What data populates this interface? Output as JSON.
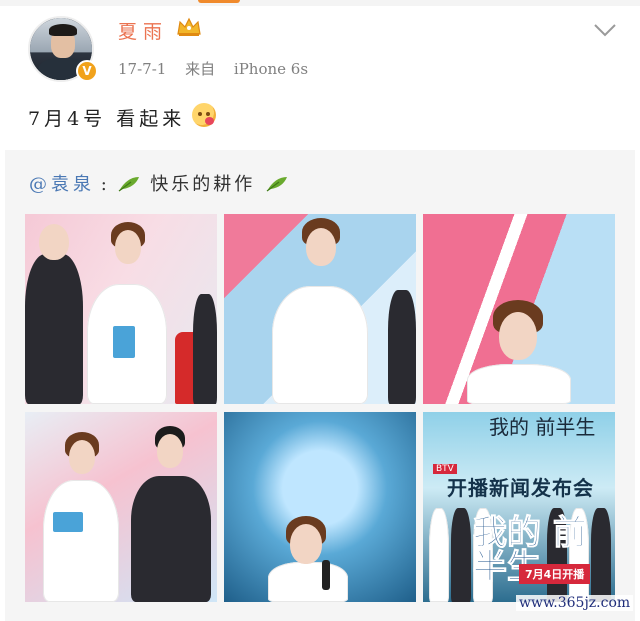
{
  "post": {
    "author": {
      "name": "夏雨",
      "badge": "V"
    },
    "meta": {
      "date": "17-7-1",
      "source_prefix": "来自",
      "device": "iPhone 6s"
    },
    "text": "7月4号 看起来",
    "emoji": "yum-face-emoji"
  },
  "repost": {
    "mention": "@袁泉",
    "separator": ":",
    "text": "快乐的耕作",
    "decor_icon": "leaf-icon"
  },
  "photos": [
    {
      "name": "photo-1"
    },
    {
      "name": "photo-2"
    },
    {
      "name": "photo-3"
    },
    {
      "name": "photo-4"
    },
    {
      "name": "photo-5"
    },
    {
      "name": "photo-6",
      "poster": {
        "title": "我的 前半生",
        "channel": "BTV",
        "event": "开播新闻发布会",
        "logo": "我的 前半生",
        "date": "7月4日开播"
      }
    }
  ],
  "watermark": "www.365jz.com",
  "colors": {
    "username": "#eb7350",
    "mention": "#4a78b4",
    "verified": "#f1a21b",
    "repost_bg": "#f5f5f5"
  }
}
